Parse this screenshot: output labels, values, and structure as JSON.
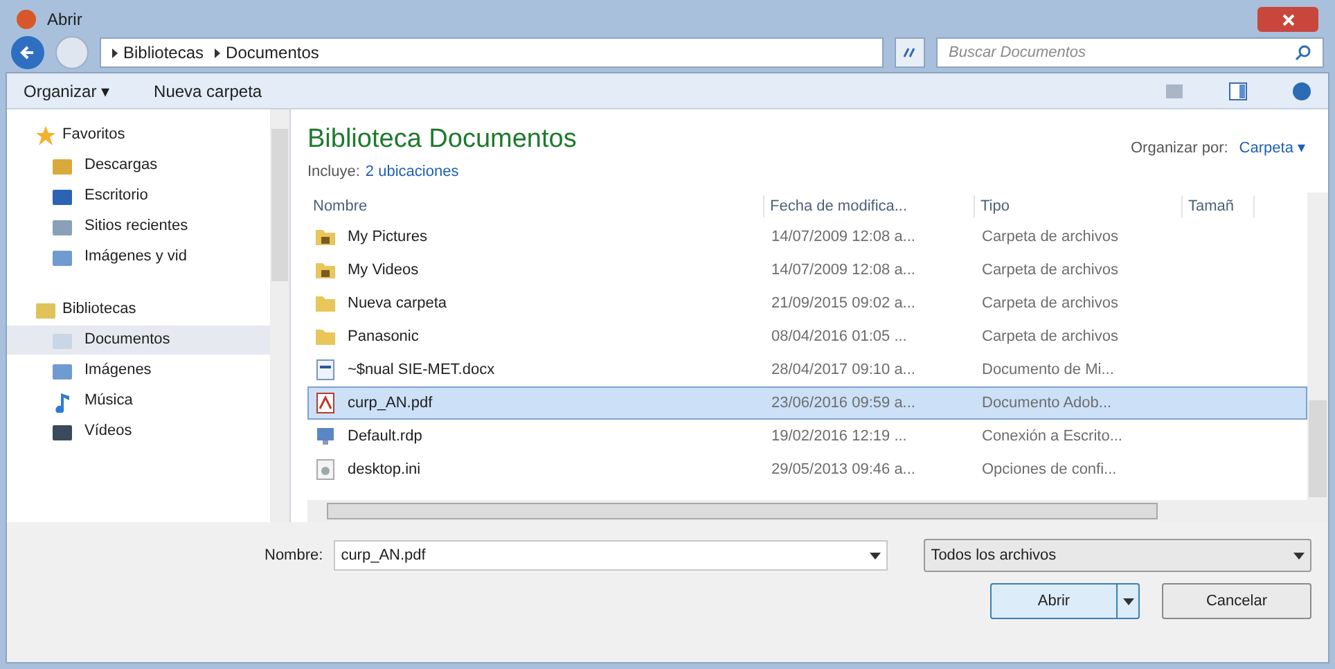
{
  "window": {
    "title": "Abrir"
  },
  "address": {
    "crumbs": [
      "Bibliotecas",
      "Documentos"
    ]
  },
  "search": {
    "placeholder": "Buscar Documentos"
  },
  "toolbar": {
    "organize": "Organizar ▾",
    "new_folder": "Nueva carpeta"
  },
  "nav": [
    {
      "label": "Favoritos",
      "kind": "star",
      "children": [
        {
          "label": "Descargas",
          "kind": "download",
          "selected": false
        },
        {
          "label": "Escritorio",
          "kind": "desktop",
          "selected": false
        },
        {
          "label": "Sitios recientes",
          "kind": "recent",
          "selected": false
        },
        {
          "label": "Imágenes y vid",
          "kind": "images",
          "selected": false
        }
      ]
    },
    {
      "label": "Bibliotecas",
      "kind": "library",
      "children": [
        {
          "label": "Documentos",
          "kind": "doc",
          "selected": true
        },
        {
          "label": "Imágenes",
          "kind": "images",
          "selected": false
        },
        {
          "label": "Música",
          "kind": "music",
          "selected": false
        },
        {
          "label": "Vídeos",
          "kind": "video",
          "selected": false
        }
      ]
    }
  ],
  "library": {
    "title": "Biblioteca Documentos",
    "includes_label": "Incluye:",
    "includes_link": "2 ubicaciones",
    "arrange_label": "Organizar por:",
    "arrange_value": "Carpeta ▾"
  },
  "table": {
    "columns": [
      "Nombre",
      "Fecha de modifica...",
      "Tipo",
      "Tamañ"
    ],
    "rows": [
      {
        "name": "My Pictures",
        "date": "14/07/2009 12:08 a...",
        "type": "Carpeta de archivos",
        "kind": "libfolder",
        "selected": false
      },
      {
        "name": "My Videos",
        "date": "14/07/2009 12:08 a...",
        "type": "Carpeta de archivos",
        "kind": "libfolder",
        "selected": false
      },
      {
        "name": "Nueva carpeta",
        "date": "21/09/2015 09:02 a...",
        "type": "Carpeta de archivos",
        "kind": "folder",
        "selected": false
      },
      {
        "name": "Panasonic",
        "date": "08/04/2016 01:05 ...",
        "type": "Carpeta de archivos",
        "kind": "folder",
        "selected": false
      },
      {
        "name": "~$nual SIE-MET.docx",
        "date": "28/04/2017 09:10 a...",
        "type": "Documento de Mi...",
        "kind": "docx",
        "selected": false
      },
      {
        "name": "curp_AN.pdf",
        "date": "23/06/2016 09:59 a...",
        "type": "Documento Adob...",
        "kind": "pdf",
        "selected": true
      },
      {
        "name": "Default.rdp",
        "date": "19/02/2016 12:19 ...",
        "type": "Conexión a Escrito...",
        "kind": "rdp",
        "selected": false
      },
      {
        "name": "desktop.ini",
        "date": "29/05/2013 09:46 a...",
        "type": "Opciones de confi...",
        "kind": "ini",
        "selected": false
      }
    ]
  },
  "filename": {
    "label": "Nombre:",
    "value": "curp_AN.pdf"
  },
  "filter": {
    "value": "Todos los archivos"
  },
  "buttons": {
    "open": "Abrir",
    "cancel": "Cancelar"
  }
}
